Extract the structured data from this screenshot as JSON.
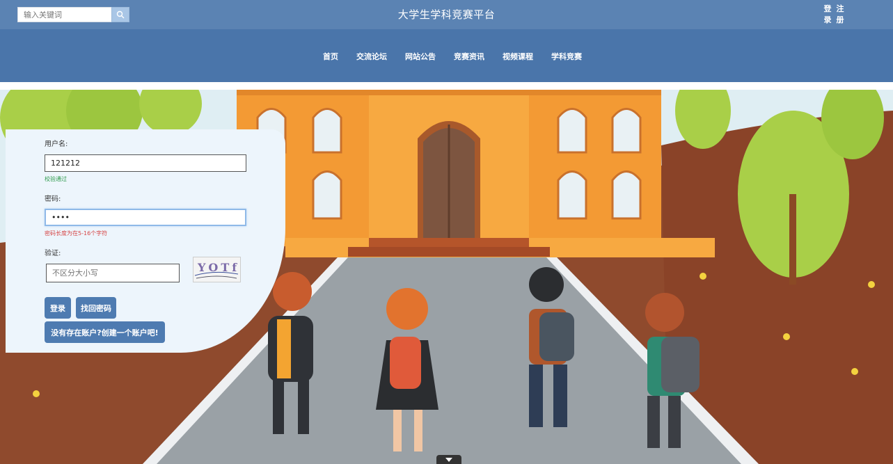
{
  "header": {
    "search_placeholder": "输入关键词",
    "site_title": "大学生学科竞赛平台",
    "auth": [
      "登",
      "注",
      "录",
      "册"
    ]
  },
  "nav": {
    "items": [
      "首页",
      "交流论坛",
      "网站公告",
      "竞赛资讯",
      "视频课程",
      "学科竞赛"
    ]
  },
  "login": {
    "username_label": "用户名:",
    "username_value": "121212",
    "username_msg": "校验通过",
    "password_label": "密码:",
    "password_value": "••••",
    "password_msg": "密码长度为在5-16个字符",
    "captcha_label": "验证:",
    "captcha_placeholder": "不区分大小写",
    "captcha_text": "YOTf",
    "login_button": "登录",
    "recover_button": "找回密码",
    "register_button": "没有存在账户?创建一个账户吧!"
  },
  "colors": {
    "header": "#5b83b3",
    "nav": "#4a75aa",
    "button": "#4e7bb1",
    "panel": "#edf5fc",
    "ok": "#2e9b4c",
    "error": "#d64545"
  }
}
